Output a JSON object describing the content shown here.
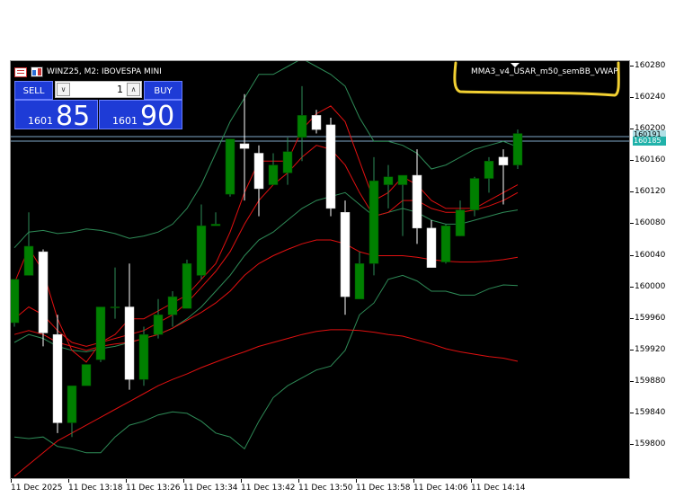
{
  "chart": {
    "symbol_line": "WINZ25, M2:  IBOVESPA MINI",
    "indicator": "MMA3_v4_USAR_m50_semBB_VWAP",
    "price_tags": {
      "ask": "160191",
      "bid": "160185"
    },
    "background": "#000000",
    "bull_color": "#008000",
    "bear_color": "#ffffff"
  },
  "trade_panel": {
    "sell_label": "SELL",
    "buy_label": "BUY",
    "lot": "1",
    "bid_prefix": "1601",
    "bid_big": "85",
    "ask_prefix": "1601",
    "ask_big": "90"
  },
  "axes": {
    "y_labels": [
      "160280",
      "160240",
      "160200",
      "160160",
      "160120",
      "160080",
      "160040",
      "160000",
      "159960",
      "159920",
      "159880",
      "159840",
      "159800"
    ],
    "x_labels": [
      "11 Dec 2025",
      "11 Dec 13:18",
      "11 Dec 13:26",
      "11 Dec 13:34",
      "11 Dec 13:42",
      "11 Dec 13:50",
      "11 Dec 13:58",
      "11 Dec 14:06",
      "11 Dec 14:14"
    ]
  },
  "chart_data": {
    "type": "candlestick",
    "ylim": [
      159770,
      160290
    ],
    "candles": [
      {
        "o": 159955,
        "h": 160010,
        "l": 159950,
        "c": 160010
      },
      {
        "o": 160015,
        "h": 160095,
        "l": 160015,
        "c": 160052
      },
      {
        "o": 160045,
        "h": 160048,
        "l": 159925,
        "c": 159942
      },
      {
        "o": 159940,
        "h": 159965,
        "l": 159815,
        "c": 159828
      },
      {
        "o": 159828,
        "h": 159855,
        "l": 159810,
        "c": 159875
      },
      {
        "o": 159875,
        "h": 159900,
        "l": 159880,
        "c": 159902
      },
      {
        "o": 159908,
        "h": 159975,
        "l": 159905,
        "c": 159975
      },
      {
        "o": 159975,
        "h": 160025,
        "l": 159960,
        "c": 159975
      },
      {
        "o": 159975,
        "h": 160030,
        "l": 159870,
        "c": 159883
      },
      {
        "o": 159883,
        "h": 159950,
        "l": 159875,
        "c": 159940
      },
      {
        "o": 159940,
        "h": 159985,
        "l": 159935,
        "c": 159965
      },
      {
        "o": 159965,
        "h": 159995,
        "l": 159950,
        "c": 159988
      },
      {
        "o": 159973,
        "h": 160035,
        "l": 159975,
        "c": 160030
      },
      {
        "o": 160015,
        "h": 160105,
        "l": 160010,
        "c": 160078
      },
      {
        "o": 160078,
        "h": 160095,
        "l": 160080,
        "c": 160080
      },
      {
        "o": 160118,
        "h": 160180,
        "l": 160115,
        "c": 160188
      },
      {
        "o": 160182,
        "h": 160245,
        "l": 160110,
        "c": 160176
      },
      {
        "o": 160170,
        "h": 160180,
        "l": 160090,
        "c": 160125
      },
      {
        "o": 160130,
        "h": 160170,
        "l": 160130,
        "c": 160155
      },
      {
        "o": 160145,
        "h": 160190,
        "l": 160130,
        "c": 160172
      },
      {
        "o": 160190,
        "h": 160255,
        "l": 160160,
        "c": 160218
      },
      {
        "o": 160218,
        "h": 160225,
        "l": 160195,
        "c": 160200
      },
      {
        "o": 160206,
        "h": 160215,
        "l": 160090,
        "c": 160100
      },
      {
        "o": 160095,
        "h": 160110,
        "l": 159965,
        "c": 159988
      },
      {
        "o": 159985,
        "h": 160045,
        "l": 159985,
        "c": 160030
      },
      {
        "o": 160030,
        "h": 160165,
        "l": 160015,
        "c": 160135
      },
      {
        "o": 160130,
        "h": 160155,
        "l": 160100,
        "c": 160140
      },
      {
        "o": 160130,
        "h": 160140,
        "l": 160065,
        "c": 160142
      },
      {
        "o": 160142,
        "h": 160175,
        "l": 160055,
        "c": 160075
      },
      {
        "o": 160075,
        "h": 160085,
        "l": 160025,
        "c": 160025
      },
      {
        "o": 160032,
        "h": 160080,
        "l": 160030,
        "c": 160078
      },
      {
        "o": 160065,
        "h": 160110,
        "l": 160075,
        "c": 160098
      },
      {
        "o": 160098,
        "h": 160140,
        "l": 160090,
        "c": 160138
      },
      {
        "o": 160138,
        "h": 160165,
        "l": 160120,
        "c": 160160
      },
      {
        "o": 160165,
        "h": 160175,
        "l": 160105,
        "c": 160155
      },
      {
        "o": 160155,
        "h": 160200,
        "l": 160150,
        "c": 160195
      }
    ],
    "red_lines": [
      [
        160005,
        160050,
        160020,
        159960,
        159920,
        159905,
        159930,
        159940,
        159960,
        159960,
        159970,
        159980,
        159990,
        160010,
        160030,
        160070,
        160120,
        160160,
        160160,
        160160,
        160200,
        160220,
        160230,
        160210,
        160160,
        160110,
        160120,
        160140,
        160130,
        160110,
        160100,
        160100,
        160100,
        160110,
        160120,
        160130
      ],
      [
        159960,
        159975,
        159965,
        159945,
        159930,
        159925,
        159930,
        159935,
        159940,
        159945,
        159955,
        159965,
        159980,
        160000,
        160020,
        160045,
        160080,
        160110,
        160130,
        160145,
        160165,
        160180,
        160175,
        160155,
        160120,
        160090,
        160095,
        160110,
        160110,
        160100,
        160095,
        160095,
        160098,
        160103,
        160110,
        160120
      ],
      [
        159940,
        159945,
        159940,
        159930,
        159925,
        159920,
        159925,
        159928,
        159930,
        159935,
        159940,
        159948,
        159958,
        159968,
        159980,
        159995,
        160015,
        160030,
        160040,
        160048,
        160055,
        160060,
        160060,
        160055,
        160045,
        160040,
        160040,
        160040,
        160038,
        160035,
        160033,
        160032,
        160032,
        160033,
        160035,
        160038
      ],
      [
        159760,
        159775,
        159790,
        159805,
        159815,
        159825,
        159835,
        159845,
        159855,
        159865,
        159875,
        159883,
        159890,
        159898,
        159905,
        159912,
        159918,
        159925,
        159930,
        159935,
        159940,
        159944,
        159946,
        159946,
        159945,
        159943,
        159940,
        159938,
        159933,
        159928,
        159922,
        159918,
        159915,
        159912,
        159910,
        159906
      ]
    ],
    "green_lines": [
      [
        160050,
        160070,
        160072,
        160068,
        160070,
        160074,
        160072,
        160068,
        160062,
        160065,
        160070,
        160080,
        160100,
        160130,
        160170,
        160210,
        160240,
        160270,
        160270,
        160280,
        160290,
        160280,
        160270,
        160255,
        160215,
        160185,
        160185,
        160180,
        160170,
        160150,
        160155,
        160165,
        160175,
        160180,
        160185,
        160178
      ],
      [
        159810,
        159808,
        159810,
        159798,
        159795,
        159790,
        159790,
        159810,
        159825,
        159830,
        159838,
        159842,
        159840,
        159830,
        159815,
        159810,
        159795,
        159830,
        159860,
        159875,
        159885,
        159895,
        159900,
        159920,
        159965,
        159980,
        160010,
        160015,
        160008,
        159995,
        159995,
        159990,
        159990,
        159998,
        160003,
        160002
      ],
      [
        159930,
        159940,
        159935,
        159925,
        159920,
        159918,
        159922,
        159925,
        159930,
        159935,
        159940,
        159948,
        159960,
        159975,
        159995,
        160015,
        160040,
        160060,
        160070,
        160085,
        160100,
        160110,
        160115,
        160120,
        160105,
        160090,
        160095,
        160100,
        160095,
        160085,
        160080,
        160080,
        160085,
        160090,
        160095,
        160098
      ]
    ]
  }
}
